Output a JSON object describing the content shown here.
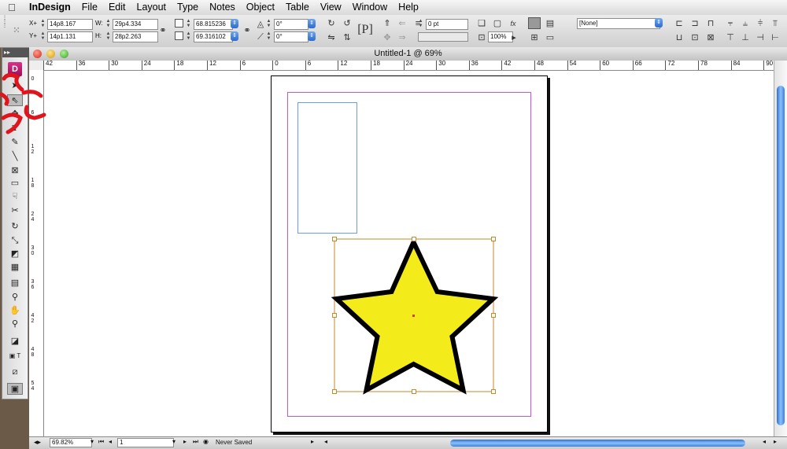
{
  "menubar": {
    "apple_icon": "apple-icon",
    "items": [
      "InDesign",
      "File",
      "Edit",
      "Layout",
      "Type",
      "Notes",
      "Object",
      "Table",
      "View",
      "Window",
      "Help"
    ]
  },
  "control": {
    "x_label": "X+",
    "x_value": "14p8.167",
    "y_label": "Y+",
    "y_value": "14p1.131",
    "w_label": "W:",
    "w_value": "29p4.334",
    "h_label": "H:",
    "h_value": "28p2.263",
    "scale_x_value": "68.815236",
    "scale_y_value": "69.316102",
    "rotate_value": "0°",
    "shear_value": "0°",
    "stroke_weight_value": "0 pt",
    "opacity_value": "100%",
    "style_value": "[None]"
  },
  "window": {
    "title": "Untitled-1 @ 69%"
  },
  "hruler_labels": [
    "42",
    "36",
    "30",
    "24",
    "18",
    "12",
    "6",
    "0",
    "6",
    "12",
    "18",
    "24",
    "30",
    "36",
    "42",
    "48",
    "54",
    "60",
    "66",
    "72",
    "78",
    "84",
    "90"
  ],
  "vruler_labels": [
    "0",
    "6",
    "1 2",
    "1 8",
    "2 4",
    "3 0",
    "3 6",
    "4 2",
    "4 8",
    "5 4"
  ],
  "status": {
    "zoom_value": "69.82%",
    "page_value": "1",
    "save_state": "Never Saved"
  },
  "toolbox": {
    "header": "▸▸",
    "logo": "D"
  },
  "colors": {
    "star_fill": "#f4ec1a",
    "star_stroke": "#000000",
    "margin_guide": "#c653e8",
    "selection": "#c58a2a",
    "text_frame": "#6b9fd6",
    "annotation": "#e0141c"
  }
}
